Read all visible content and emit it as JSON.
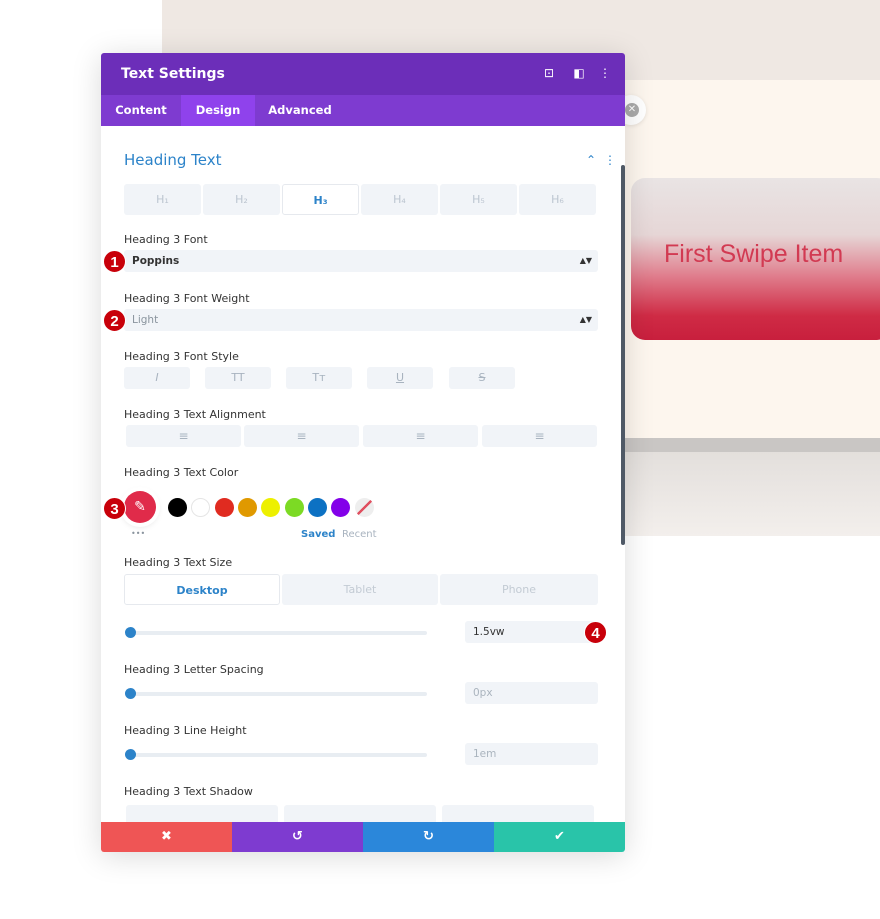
{
  "preview": {
    "card_title": "First Swipe Item"
  },
  "panel": {
    "title": "Text Settings",
    "header_icons": [
      "focus-icon",
      "split-view-icon",
      "more-vertical-icon"
    ],
    "tabs": [
      {
        "label": "Content"
      },
      {
        "label": "Design",
        "active": true
      },
      {
        "label": "Advanced"
      }
    ],
    "section_title": "Heading Text",
    "heading_levels": [
      {
        "label": "H₁"
      },
      {
        "label": "H₂"
      },
      {
        "label": "H₃",
        "active": true
      },
      {
        "label": "H₄"
      },
      {
        "label": "H₅"
      },
      {
        "label": "H₆"
      }
    ],
    "font": {
      "label": "Heading 3 Font",
      "value": "Poppins"
    },
    "weight": {
      "label": "Heading 3 Font Weight",
      "value": "Light"
    },
    "style": {
      "label": "Heading 3 Font Style",
      "buttons": [
        "I",
        "TT",
        "Tт",
        "U",
        "S"
      ]
    },
    "alignment": {
      "label": "Heading 3 Text Alignment",
      "buttons": [
        "≡",
        "≡",
        "≡",
        "≡"
      ]
    },
    "color": {
      "label": "Heading 3 Text Color",
      "active_color": "#e02b4a",
      "swatches": [
        "#000000",
        "#ffffff",
        "#e02b20",
        "#e09900",
        "#edf000",
        "#7cda24",
        "#0c71c3",
        "#8300e9"
      ],
      "saved": "Saved",
      "recent": "Recent",
      "more": "•••"
    },
    "size": {
      "label": "Heading 3 Text Size",
      "devices": [
        "Desktop",
        "Tablet",
        "Phone"
      ],
      "value": "1.5vw"
    },
    "letter_spacing": {
      "label": "Heading 3 Letter Spacing",
      "value": "0px"
    },
    "line_height": {
      "label": "Heading 3 Line Height",
      "value": "1em"
    },
    "text_shadow": {
      "label": "Heading 3 Text Shadow"
    },
    "footer": {
      "cancel": "✖",
      "undo": "↺",
      "redo": "↻",
      "save": "✔"
    },
    "colors": {
      "header": "#6c2eb9",
      "tabs": "#7e3bd0",
      "accent": "#2c83c9",
      "cancel": "#ef5555",
      "undo": "#7e3bd0",
      "redo": "#2b87da",
      "save": "#29c4a9"
    }
  },
  "badges": [
    "1",
    "2",
    "3",
    "4"
  ]
}
